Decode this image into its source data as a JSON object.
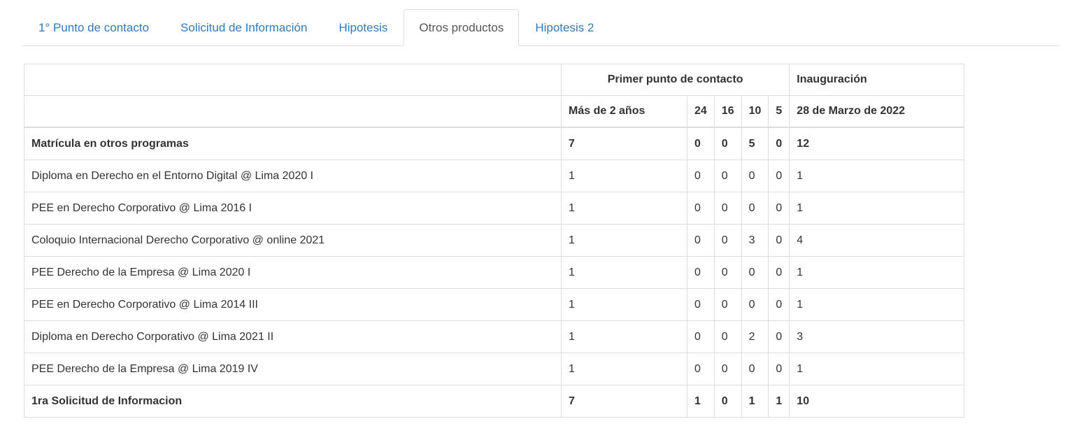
{
  "tabs": [
    {
      "label": "1° Punto de contacto",
      "active": false
    },
    {
      "label": "Solicitud de Información",
      "active": false
    },
    {
      "label": "Hipotesis",
      "active": false
    },
    {
      "label": "Otros productos",
      "active": true
    },
    {
      "label": "Hipotesis 2",
      "active": false
    }
  ],
  "table": {
    "group_headers": {
      "primer_punto": "Primer punto de contacto",
      "inauguracion": "Inauguración"
    },
    "sub_headers": [
      "Más de 2 años",
      "24",
      "16",
      "10",
      "5",
      "28 de Marzo de 2022"
    ],
    "rows": [
      {
        "label": "Matrícula en otros programas",
        "values": [
          "7",
          "0",
          "0",
          "5",
          "0",
          "12"
        ],
        "bold": true
      },
      {
        "label": "Diploma en Derecho en el Entorno Digital @ Lima 2020 I",
        "values": [
          "1",
          "0",
          "0",
          "0",
          "0",
          "1"
        ],
        "bold": false
      },
      {
        "label": "PEE en Derecho Corporativo @ Lima 2016 I",
        "values": [
          "1",
          "0",
          "0",
          "0",
          "0",
          "1"
        ],
        "bold": false
      },
      {
        "label": "Coloquio Internacional Derecho Corporativo @ online 2021",
        "values": [
          "1",
          "0",
          "0",
          "3",
          "0",
          "4"
        ],
        "bold": false
      },
      {
        "label": "PEE Derecho de la Empresa @ Lima 2020 I",
        "values": [
          "1",
          "0",
          "0",
          "0",
          "0",
          "1"
        ],
        "bold": false
      },
      {
        "label": "PEE en Derecho Corporativo @ Lima 2014 III",
        "values": [
          "1",
          "0",
          "0",
          "0",
          "0",
          "1"
        ],
        "bold": false
      },
      {
        "label": "Diploma en Derecho Corporativo @ Lima 2021 II",
        "values": [
          "1",
          "0",
          "0",
          "2",
          "0",
          "3"
        ],
        "bold": false
      },
      {
        "label": "PEE Derecho de la Empresa @ Lima 2019 IV",
        "values": [
          "1",
          "0",
          "0",
          "0",
          "0",
          "1"
        ],
        "bold": false
      },
      {
        "label": "1ra Solicitud de Informacion",
        "values": [
          "7",
          "1",
          "0",
          "1",
          "1",
          "10"
        ],
        "bold": true
      }
    ]
  }
}
